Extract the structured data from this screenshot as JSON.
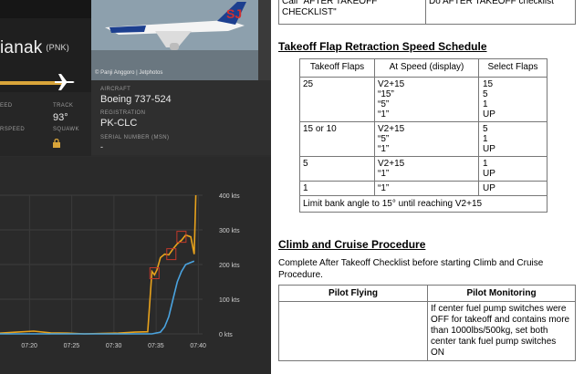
{
  "flight_panel": {
    "destination_name": "ianak",
    "destination_code": "(PNK)",
    "photo_credit": "© Panji Anggoro | Jetphotos",
    "speed_label": "EED",
    "airspeed_label": "RSPEED",
    "track_label": "TRACK",
    "track_value": "93°",
    "squawk_label": "SQUAWK",
    "aircraft_label": "AIRCRAFT",
    "aircraft_value": "Boeing 737-524",
    "registration_label": "REGISTRATION",
    "registration_value": "PK-CLC",
    "serial_label": "SERIAL NUMBER (MSN)",
    "serial_value": "-",
    "flight_progress": 0.68,
    "colors": {
      "accent": "#d9a53a",
      "panel": "#2c2c2c",
      "speed_line": "#4aa3df",
      "alt_line": "#e8a21c",
      "marker": "#c0392b"
    }
  },
  "chart_data": {
    "type": "line",
    "x": [
      "07:20",
      "07:25",
      "07:30",
      "07:35",
      "07:40"
    ],
    "y_ticks": [
      "0 kts",
      "100 kts",
      "200 kts",
      "300 kts",
      "400 kts"
    ],
    "ylim": [
      0,
      400
    ],
    "series": [
      {
        "color": "#e8a21c",
        "points": [
          [
            0,
            2
          ],
          [
            2,
            5
          ],
          [
            4,
            8
          ],
          [
            6,
            3
          ],
          [
            8,
            2
          ],
          [
            10,
            0
          ],
          [
            12,
            1
          ],
          [
            14,
            2
          ],
          [
            16,
            5
          ],
          [
            17.5,
            6
          ],
          [
            18,
            180
          ],
          [
            18.3,
            170
          ],
          [
            18.6,
            185
          ],
          [
            19,
            220
          ],
          [
            19.5,
            230
          ],
          [
            20,
            228
          ],
          [
            20.5,
            245
          ],
          [
            21,
            260
          ],
          [
            21.5,
            270
          ],
          [
            22,
            285
          ],
          [
            22.6,
            280
          ],
          [
            23,
            230
          ],
          [
            23.2,
            400
          ]
        ]
      },
      {
        "color": "#4aa3df",
        "points": [
          [
            0,
            0
          ],
          [
            18,
            0
          ],
          [
            19,
            5
          ],
          [
            19.5,
            20
          ],
          [
            20,
            50
          ],
          [
            20.5,
            100
          ],
          [
            21,
            150
          ],
          [
            21.5,
            180
          ],
          [
            22,
            200
          ],
          [
            22.5,
            205
          ],
          [
            23,
            210
          ]
        ]
      }
    ],
    "markers": [
      [
        18.3,
        175
      ],
      [
        20.3,
        230
      ],
      [
        21.5,
        280
      ]
    ]
  },
  "doc": {
    "top_row": {
      "left": "Call \"AFTER TAKEOFF CHECKLIST\"",
      "right": "Do AFTER TAKEOFF checklist"
    },
    "flap_heading": "Takeoff Flap Retraction Speed Schedule",
    "flap_table": {
      "headers": [
        "Takeoff Flaps",
        "At Speed (display)",
        "Select Flaps"
      ],
      "rows": [
        [
          "25",
          "V2+15\n“15”\n“5”\n“1”",
          "15\n5\n1\nUP"
        ],
        [
          "15 or 10",
          "V2+15\n“5”\n“1”",
          "5\n1\nUP"
        ],
        [
          "5",
          "V2+15\n“1”",
          "1\nUP"
        ],
        [
          "1",
          "“1”",
          "UP"
        ]
      ],
      "footer": "Limit bank angle to 15° until reaching V2+15"
    },
    "climb_heading": "Climb and Cruise Procedure",
    "climb_text": "Complete After Takeoff Checklist before starting Climb and Cruise Procedure.",
    "pilot_table": {
      "headers": [
        "Pilot Flying",
        "Pilot Monitoring"
      ],
      "row": [
        "",
        "If center fuel pump switches were OFF for takeoff and contains more than 1000lbs/500kg, set both center tank fuel pump switches ON"
      ]
    }
  }
}
